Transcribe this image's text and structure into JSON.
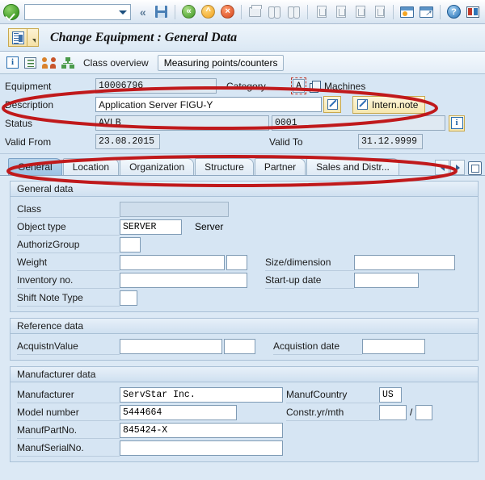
{
  "toolbar": {
    "command_value": "",
    "icons": [
      {
        "name": "enter-ok-icon",
        "label": "Enter"
      },
      {
        "name": "back-chevrons-icon",
        "label": "Back"
      },
      {
        "name": "save-icon",
        "label": "Save"
      },
      {
        "name": "back-green-icon",
        "label": "Back"
      },
      {
        "name": "exit-yellow-icon",
        "label": "Exit"
      },
      {
        "name": "cancel-red-icon",
        "label": "Cancel"
      },
      {
        "name": "print-icon",
        "label": "Print"
      },
      {
        "name": "find-icon",
        "label": "Find"
      },
      {
        "name": "find-next-icon",
        "label": "Find Next"
      },
      {
        "name": "first-page-icon",
        "label": "First Page"
      },
      {
        "name": "previous-page-icon",
        "label": "Previous Page"
      },
      {
        "name": "next-page-icon",
        "label": "Next Page"
      },
      {
        "name": "last-page-icon",
        "label": "Last Page"
      },
      {
        "name": "create-session-icon",
        "label": "Create New Session"
      },
      {
        "name": "create-shortcut-icon",
        "label": "Create Shortcut"
      },
      {
        "name": "help-icon",
        "label": "Help"
      },
      {
        "name": "customize-layout-icon",
        "label": "Customize Local Layout"
      }
    ]
  },
  "window": {
    "title": "Change Equipment : General Data",
    "menu_icon": "sap-menu-icon"
  },
  "apptoolbar": {
    "icons": [
      {
        "name": "info-icon",
        "label": "Information"
      },
      {
        "name": "list-icon",
        "label": "List"
      },
      {
        "name": "partners-icon",
        "label": "Partners"
      },
      {
        "name": "structure-icon",
        "label": "Structure"
      }
    ],
    "class_overview_label": "Class overview",
    "measuring_points_label": "Measuring points/counters"
  },
  "header": {
    "equipment_label": "Equipment",
    "equipment_value": "10006796",
    "category_label": "Category",
    "category_value": "A",
    "category_text": "Machines",
    "description_label": "Description",
    "description_value": "Application Server FIGU-Y",
    "intern_note_label": "Intern.note",
    "status_label": "Status",
    "status_value": "AVLB",
    "status_value2": "0001",
    "valid_from_label": "Valid From",
    "valid_from_value": "23.08.2015",
    "valid_to_label": "Valid To",
    "valid_to_value": "31.12.9999"
  },
  "tabs": [
    {
      "label": "General",
      "active": true
    },
    {
      "label": "Location",
      "active": false
    },
    {
      "label": "Organization",
      "active": false
    },
    {
      "label": "Structure",
      "active": false
    },
    {
      "label": "Partner",
      "active": false
    },
    {
      "label": "Sales and Distr...",
      "active": false
    }
  ],
  "groups": {
    "general_data": {
      "title": "General data",
      "class_label": "Class",
      "class_value": "",
      "object_type_label": "Object type",
      "object_type_value": "SERVER",
      "object_type_text": "Server",
      "authoriz_group_label": "AuthorizGroup",
      "authoriz_group_value": "",
      "weight_label": "Weight",
      "weight_value": "",
      "weight_unit": "",
      "size_dimension_label": "Size/dimension",
      "size_dimension_value": "",
      "inventory_no_label": "Inventory no.",
      "inventory_no_value": "",
      "startup_date_label": "Start-up date",
      "startup_date_value": "",
      "shift_note_type_label": "Shift Note Type",
      "shift_note_type_value": ""
    },
    "reference_data": {
      "title": "Reference data",
      "acquistn_value_label": "AcquistnValue",
      "acquistn_value": "",
      "acquistn_currency": "",
      "acquistion_date_label": "Acquistion date",
      "acquistion_date_value": ""
    },
    "manufacturer_data": {
      "title": "Manufacturer data",
      "manufacturer_label": "Manufacturer",
      "manufacturer_value": "ServStar Inc.",
      "manuf_country_label": "ManufCountry",
      "manuf_country_value": "US",
      "model_number_label": "Model number",
      "model_number_value": "5444664",
      "constr_yr_mth_label": "Constr.yr/mth",
      "constr_yr_value": "",
      "constr_mth_value": "",
      "constr_separator": "/",
      "manuf_part_no_label": "ManufPartNo.",
      "manuf_part_no_value": "845424-X",
      "manuf_serial_no_label": "ManufSerialNo.",
      "manuf_serial_no_value": ""
    }
  },
  "annotations": {
    "highlight_color": "#c0191b",
    "ovals": [
      {
        "name": "header-fields-highlight"
      },
      {
        "name": "tabstrip-highlight"
      }
    ]
  }
}
